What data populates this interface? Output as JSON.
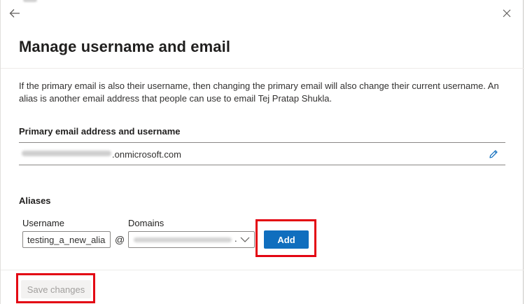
{
  "panel": {
    "title": "Manage username and email",
    "description": "If the primary email is also their username, then changing the primary email will also change their current username. An alias is another email address that people can use to email Tej Pratap Shukla."
  },
  "primary_email": {
    "section_label": "Primary email address and username",
    "domain_suffix": ".onmicrosoft.com"
  },
  "aliases": {
    "section_label": "Aliases",
    "username_label": "Username",
    "domains_label": "Domains",
    "username_value": "testing_a_new_alias",
    "at_symbol": "@",
    "domain_trailing": ".",
    "add_label": "Add"
  },
  "footer": {
    "save_label": "Save changes"
  },
  "icons": {
    "back": "back-arrow-icon",
    "close": "close-icon",
    "edit": "pencil-icon",
    "dropdown": "chevron-down-icon"
  },
  "colors": {
    "accent": "#106ebe",
    "highlight": "#e30613",
    "disabled_bg": "#f3f2f1",
    "disabled_text": "#a19f9d"
  }
}
